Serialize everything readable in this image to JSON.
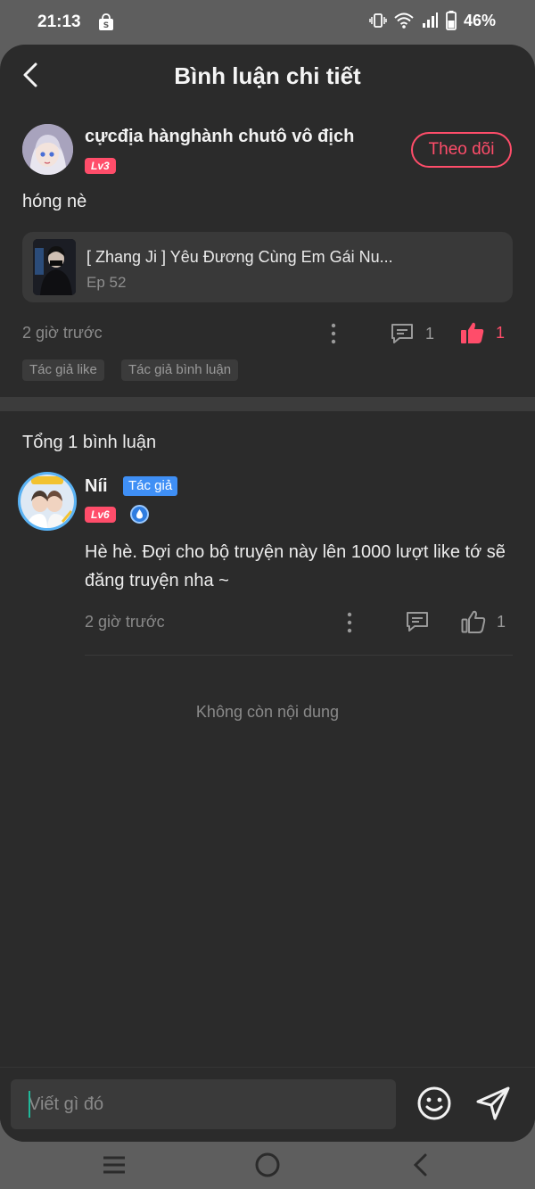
{
  "status_bar": {
    "time": "21:13",
    "battery_percent": "46%",
    "icons": [
      "shopee-bag-icon",
      "vibrate-icon",
      "wifi-icon",
      "signal-icon",
      "battery-icon"
    ]
  },
  "header": {
    "title": "Bình luận chi tiết",
    "back_icon": "chevron-left-icon"
  },
  "post": {
    "username": "cựcđịa hànghành chutô vô địch",
    "level": "Lv3",
    "follow_label": "Theo dõi",
    "text": "hóng nè",
    "story": {
      "title": "[ Zhang Ji ] Yêu Đương Cùng Em Gái Nu...",
      "episode": "Ep 52"
    },
    "time": "2 giờ trước",
    "comment_count": "1",
    "like_count": "1",
    "tags": [
      "Tác giả like",
      "Tác giả bình luận"
    ]
  },
  "comments": {
    "total_label": "Tổng 1 bình luận",
    "items": [
      {
        "username": "Níi",
        "badge": "Tác giả",
        "level": "Lv6",
        "text": "Hè hè. Đợi cho bộ truyện này lên 1000 lượt like tớ sẽ đăng truyện nha ~",
        "time": "2 giờ trước",
        "like_count": "1"
      }
    ],
    "end_label": "Không còn nội dung"
  },
  "composer": {
    "placeholder": "Viết gì đó"
  },
  "colors": {
    "accent": "#ff4d6a",
    "author_badge": "#3f8ff5",
    "background": "#2b2b2b"
  }
}
